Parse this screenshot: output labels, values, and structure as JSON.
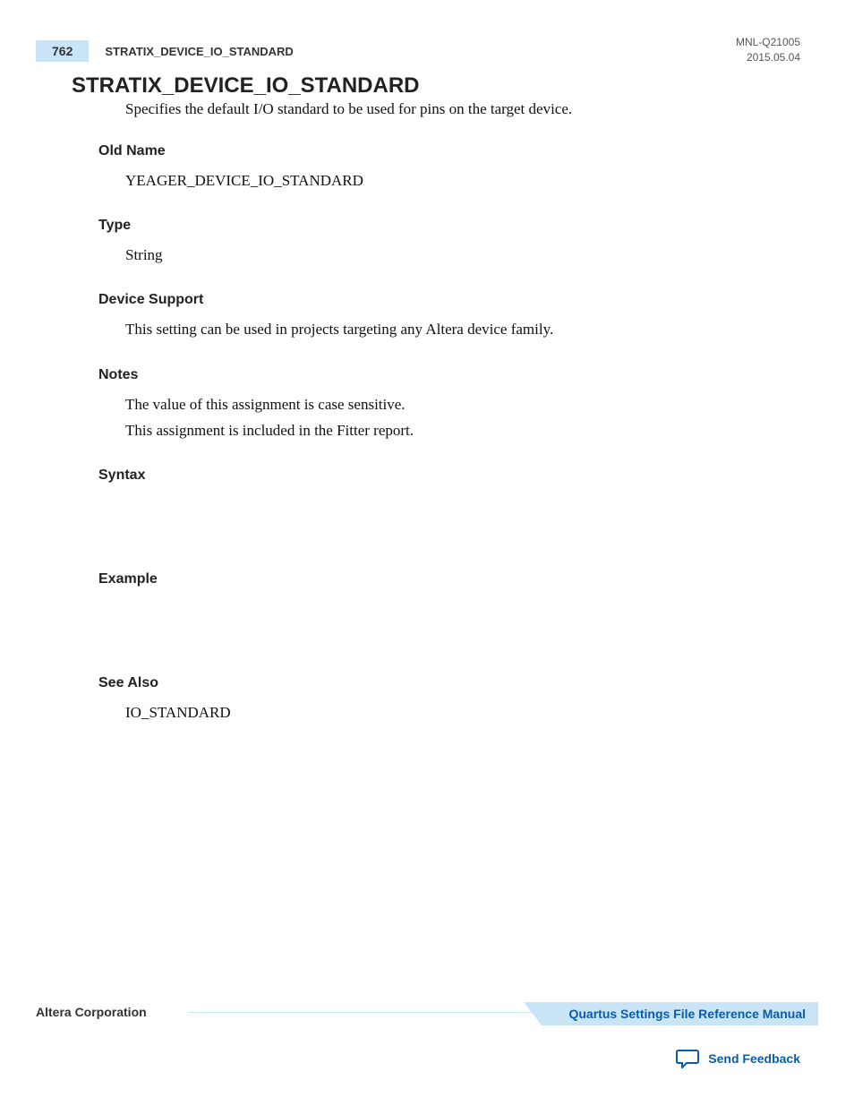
{
  "header": {
    "page_number": "762",
    "running_title": "STRATIX_DEVICE_IO_STANDARD",
    "doc_id": "MNL-Q21005",
    "date": "2015.05.04"
  },
  "title": "STRATIX_DEVICE_IO_STANDARD",
  "description": "Specifies the default I/O standard to be used for pins on the target device.",
  "sections": {
    "old_name": {
      "heading": "Old Name",
      "body": "YEAGER_DEVICE_IO_STANDARD"
    },
    "type": {
      "heading": "Type",
      "body": "String"
    },
    "device_support": {
      "heading": "Device Support",
      "body": "This setting can be used in projects targeting any Altera device family."
    },
    "notes": {
      "heading": "Notes",
      "line1": "The value of this assignment is case sensitive.",
      "line2": "This assignment is included in the Fitter report."
    },
    "syntax": {
      "heading": "Syntax"
    },
    "example": {
      "heading": "Example"
    },
    "see_also": {
      "heading": "See Also",
      "body": "IO_STANDARD"
    }
  },
  "footer": {
    "left": "Altera Corporation",
    "right": "Quartus Settings File Reference Manual",
    "feedback": "Send Feedback"
  }
}
